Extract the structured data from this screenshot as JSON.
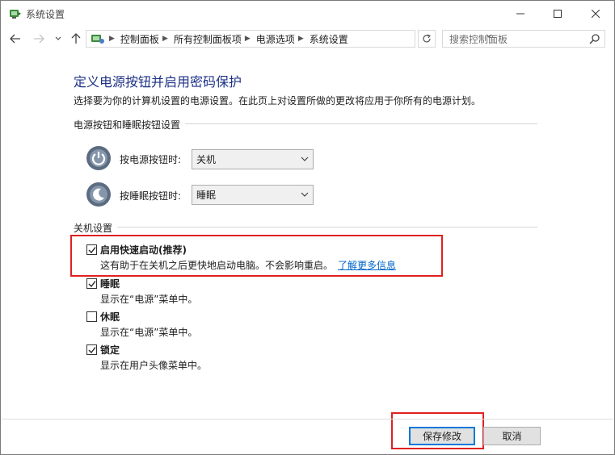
{
  "window": {
    "title": "系统设置"
  },
  "nav": {
    "breadcrumbs": [
      "控制面板",
      "所有控制面板项",
      "电源选项",
      "系统设置"
    ],
    "search_placeholder": "搜索控制面板"
  },
  "page": {
    "title": "定义电源按钮并启用密码保护",
    "description": "选择要为你的计算机设置的电源设置。在此页上对设置所做的更改将应用于你所有的电源计划。"
  },
  "buttons_section": {
    "label": "电源按钮和睡眠按钮设置",
    "power_button": {
      "label": "按电源按钮时:",
      "value": "关机"
    },
    "sleep_button": {
      "label": "按睡眠按钮时:",
      "value": "睡眠"
    }
  },
  "shutdown_section": {
    "label": "关机设置",
    "options": [
      {
        "title": "启用快速启动(推荐)",
        "desc": "这有助于在关机之后更快地启动电脑。不会影响重启。",
        "link": "了解更多信息",
        "checked": true
      },
      {
        "title": "睡眠",
        "desc": "显示在“电源”菜单中。",
        "checked": true
      },
      {
        "title": "休眠",
        "desc": "显示在“电源”菜单中。",
        "checked": false
      },
      {
        "title": "锁定",
        "desc": "显示在用户头像菜单中。",
        "checked": true
      }
    ]
  },
  "footer": {
    "save_label": "保存修改",
    "cancel_label": "取消"
  },
  "colors": {
    "title_blue": "#1e3287",
    "link_blue": "#0066cc",
    "highlight_red": "#e02020",
    "focus_blue": "#0078d7"
  }
}
